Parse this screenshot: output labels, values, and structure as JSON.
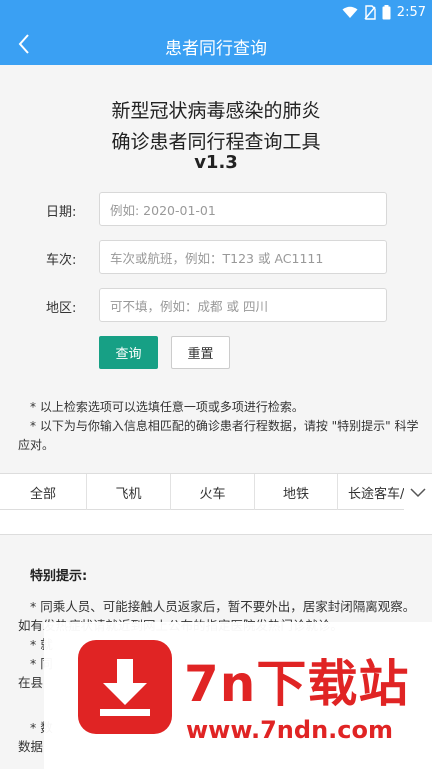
{
  "status_bar": {
    "time": "2:57"
  },
  "header": {
    "title": "患者同行查询"
  },
  "tool": {
    "title_line1": "新型冠状病毒感染的肺炎",
    "title_line2": "确诊患者同行程查询工具",
    "version": "v1.3"
  },
  "form": {
    "date_label": "日期:",
    "date_placeholder": "例如: 2020-01-01",
    "train_label": "车次:",
    "train_placeholder": "车次或航班，例如：T123 或 AC1111",
    "area_label": "地区:",
    "area_placeholder": "可不填，例如：成都 或 四川",
    "search_button": "查询",
    "reset_button": "重置"
  },
  "notes": {
    "note1": "* 以上检索选项可以选填任意一项或多项进行检索。",
    "note2": "* 以下为与你输入信息相匹配的确诊患者行程数据，请按 \"特别提示\" 科学应对。"
  },
  "tabs": [
    {
      "label": "全部"
    },
    {
      "label": "飞机"
    },
    {
      "label": "火车"
    },
    {
      "label": "地铁"
    },
    {
      "label": "长途客车/"
    }
  ],
  "tips": {
    "heading": "特别提示:",
    "tip1": "* 同乘人员、可能接触人员返家后，暂不要外出，居家封闭隔离观察。如有发热症状请就近到网上公布的指定医院发热门诊就诊。",
    "tip2_partial": "* 就",
    "tip3_partial": "* 同",
    "tip3_cont": "在县",
    "tip4_partial": "* 数",
    "tip4_cont": "数据"
  },
  "watermark": {
    "big_text": "7n下载站",
    "url": "www.7ndn.com"
  },
  "colors": {
    "header_bg": "#3aa0f3",
    "primary_button": "#17a085",
    "watermark_red": "#e02424"
  }
}
